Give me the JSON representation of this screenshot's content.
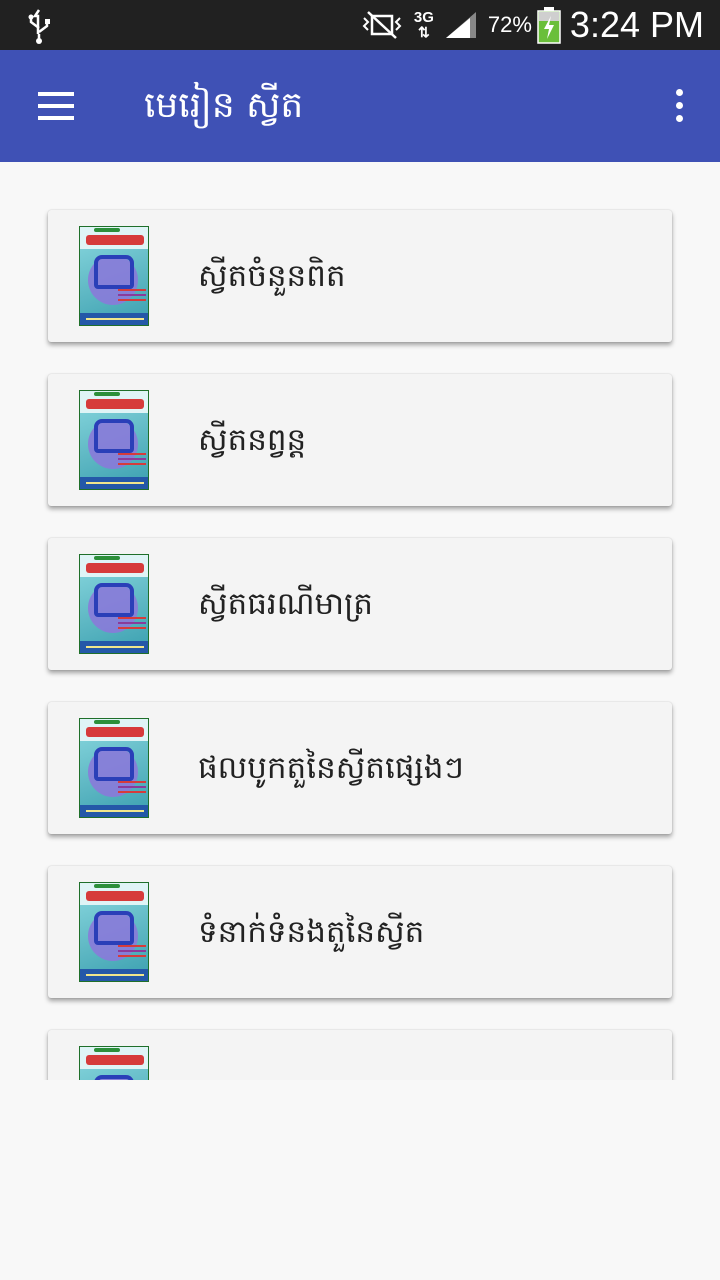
{
  "status_bar": {
    "network": "3G",
    "battery": "72%",
    "time": "3:24 PM"
  },
  "app_bar": {
    "title": "មេរៀន ស្វីត"
  },
  "lessons": [
    {
      "label": "ស្វីតចំនួនពិត"
    },
    {
      "label": "ស្វីតនព្វន្ត"
    },
    {
      "label": "ស្វីតធរណីមាត្រ"
    },
    {
      "label": "ផលបូកតួនៃស្វីតផ្សេងៗ"
    },
    {
      "label": "ទំនាក់ទំនងតួនៃស្វីត"
    },
    {
      "label": ""
    }
  ],
  "colors": {
    "app_bar": "#3f51b5",
    "status_bar": "#212121",
    "background": "#f8f8f8",
    "card": "#f4f4f4"
  }
}
